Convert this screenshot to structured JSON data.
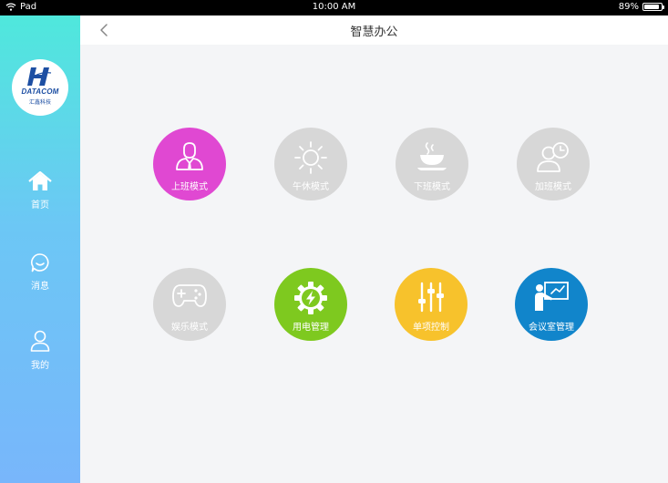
{
  "status_bar": {
    "device": "Pad",
    "time": "10:00 AM",
    "battery": "89%",
    "battery_level": 0.89
  },
  "logo": {
    "brand": "DATACOM",
    "brand_cn": "汇鑫科技"
  },
  "sidebar": {
    "items": [
      {
        "label": "首页",
        "icon": "home-icon"
      },
      {
        "label": "消息",
        "icon": "message-icon"
      },
      {
        "label": "我的",
        "icon": "user-icon"
      }
    ]
  },
  "header": {
    "title": "智慧办公",
    "back_icon": "chevron-left-icon"
  },
  "modes": [
    {
      "label": "上班模式",
      "icon": "worker-icon",
      "color": "#e048d2"
    },
    {
      "label": "午休模式",
      "icon": "sun-icon",
      "color": "#d7d7d7"
    },
    {
      "label": "下班模式",
      "icon": "coffee-cup-icon",
      "color": "#d7d7d7"
    },
    {
      "label": "加班模式",
      "icon": "person-clock-icon",
      "color": "#d7d7d7"
    },
    {
      "label": "娱乐模式",
      "icon": "gamepad-icon",
      "color": "#d7d7d7"
    },
    {
      "label": "用电管理",
      "icon": "power-gear-icon",
      "color": "#7ec91f"
    },
    {
      "label": "单项控制",
      "icon": "sliders-icon",
      "color": "#f7c22c"
    },
    {
      "label": "会议室管理",
      "icon": "presentation-icon",
      "color": "#1185cb"
    }
  ]
}
